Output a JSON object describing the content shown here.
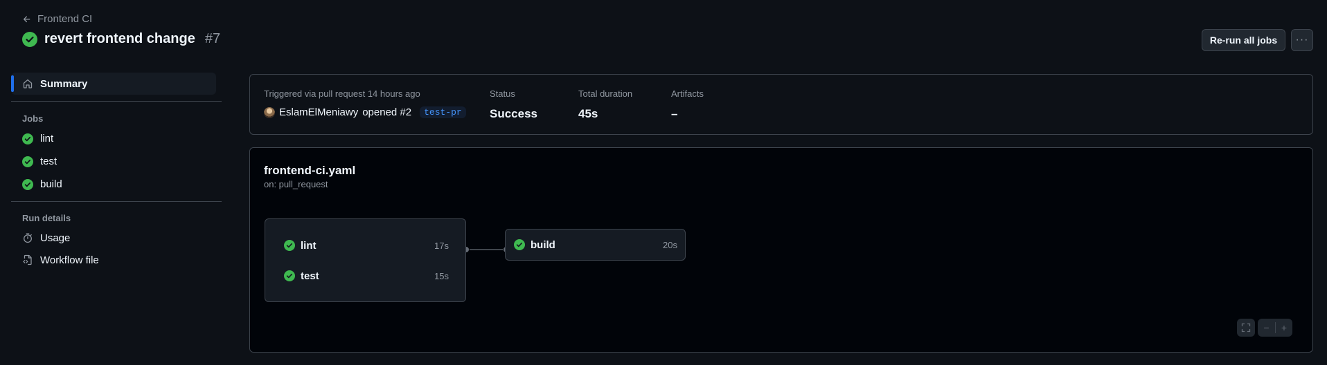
{
  "header": {
    "back_label": "Frontend CI",
    "title": "revert frontend change",
    "run_number": "#7",
    "rerun_label": "Re-run all jobs",
    "more_label": "···"
  },
  "sidebar": {
    "summary_label": "Summary",
    "jobs_heading": "Jobs",
    "jobs": [
      {
        "label": "lint",
        "status": "success"
      },
      {
        "label": "test",
        "status": "success"
      },
      {
        "label": "build",
        "status": "success"
      }
    ],
    "details_heading": "Run details",
    "details": [
      {
        "label": "Usage",
        "icon": "stopwatch-icon"
      },
      {
        "label": "Workflow file",
        "icon": "file-code-icon"
      }
    ]
  },
  "summary": {
    "trigger_label": "Triggered via pull request 14 hours ago",
    "actor": "EslamElMeniawy",
    "action": "opened #2",
    "branch": "test-pr",
    "status_label": "Status",
    "status_value": "Success",
    "duration_label": "Total duration",
    "duration_value": "45s",
    "artifacts_label": "Artifacts",
    "artifacts_value": "–"
  },
  "workflow": {
    "file_name": "frontend-ci.yaml",
    "trigger": "on: pull_request",
    "jobs": [
      {
        "name": "lint",
        "duration": "17s",
        "status": "success"
      },
      {
        "name": "test",
        "duration": "15s",
        "status": "success"
      },
      {
        "name": "build",
        "duration": "20s",
        "status": "success"
      }
    ],
    "zoom_out_label": "−",
    "zoom_in_label": "+"
  },
  "colors": {
    "background": "#0d1117",
    "success": "#3fb950",
    "accent": "#1f6feb",
    "border": "#3d444d",
    "muted_text": "#9198a1"
  }
}
